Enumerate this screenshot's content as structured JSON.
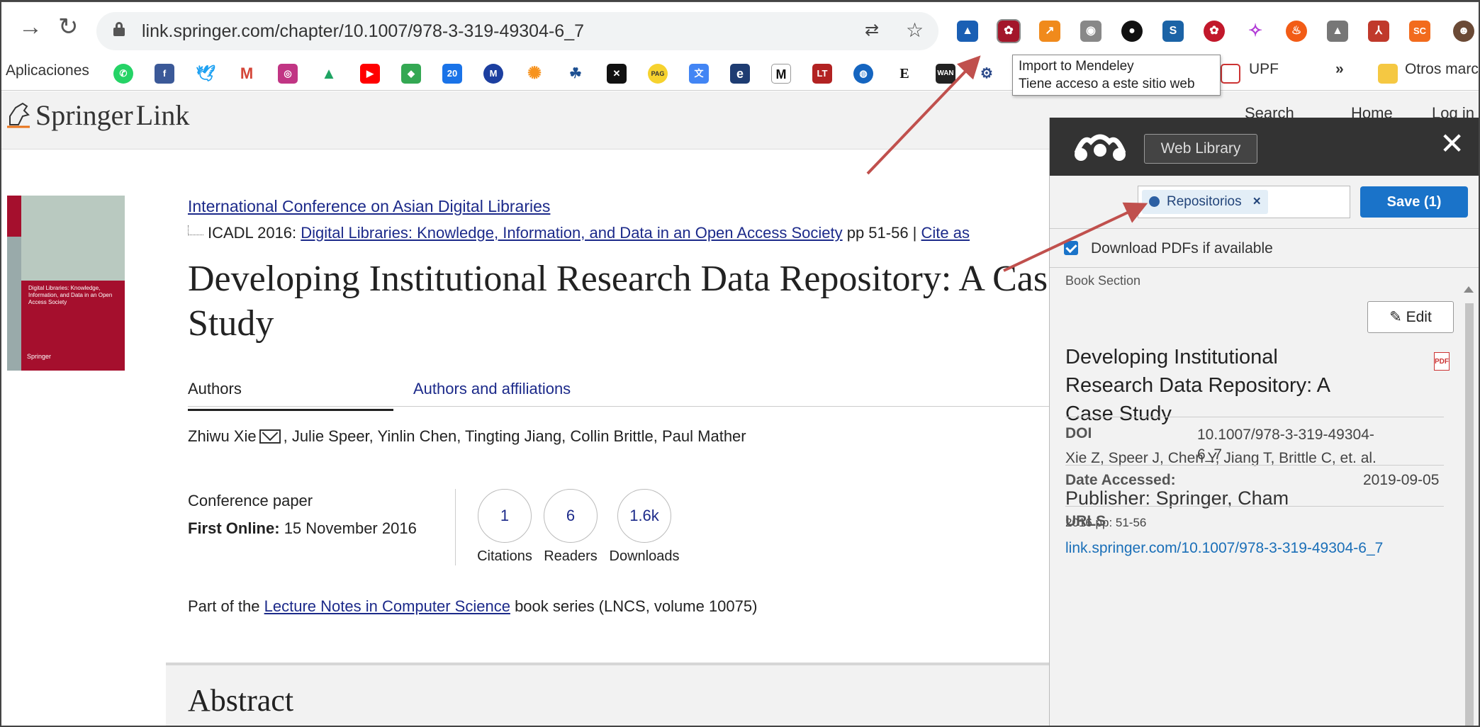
{
  "browser": {
    "url": "link.springer.com/chapter/10.1007/978-3-319-49304-6_7",
    "extensions": [
      "graduation-cap",
      "mendeley",
      "chart",
      "camera",
      "circle",
      "bookmark",
      "mendeley-red",
      "star",
      "fire",
      "drive",
      "pdf",
      "sc"
    ],
    "extension_labels": {
      "sc": "SC"
    }
  },
  "bookmarks": {
    "apps_label": "Aplicaciones",
    "items": [
      "whatsapp",
      "facebook",
      "twitter",
      "gmail",
      "instagram",
      "drive",
      "youtube",
      "maps",
      "calendar",
      "m-circle",
      "sun",
      "puzzle",
      "x-app",
      "pag",
      "translate",
      "e-app",
      "medium",
      "lt",
      "globe",
      "e-letter",
      "wan",
      "gear"
    ],
    "item_labels": {
      "calendar": "20",
      "m-circle": "M",
      "pag": "PAG",
      "e-app": "e",
      "medium": "M",
      "lt": "LT",
      "e-letter": "E",
      "wan": "WAN"
    },
    "upf_label": "UPF",
    "more_label": "»",
    "others_label": "Otros marc"
  },
  "tooltip": {
    "line1": "Import to Mendeley",
    "line2": "Tiene acceso a este sitio web"
  },
  "springer": {
    "logo_text_1": "Springer",
    "logo_text_2": "Link",
    "nav_search": "Search",
    "nav_home": "Home",
    "nav_login": "Log in"
  },
  "article": {
    "cover_text": "Digital Libraries: Knowledge, Information, and Data in an Open Access Society",
    "cover_publisher": "Springer",
    "conference_link": "International Conference on Asian Digital Libraries",
    "icadl_prefix": "ICADL 2016:",
    "icadl_link": "Digital Libraries: Knowledge, Information, and Data in an Open Access Society",
    "icadl_pages": "pp 51-56 |",
    "cite_as": "Cite as",
    "title": "Developing Institutional Research Data Repository: A Case Study",
    "tab_authors": "Authors",
    "tab_affiliations": "Authors and affiliations",
    "author_first": "Zhiwu Xie",
    "authors_rest": ", Julie Speer, Yinlin Chen, Tingting Jiang, Collin Brittle, Paul Mather",
    "paper_type": "Conference paper",
    "first_online_label": "First Online:",
    "first_online_date": "15 November 2016",
    "metrics": [
      {
        "value": "1",
        "label": "Citations"
      },
      {
        "value": "6",
        "label": "Readers"
      },
      {
        "value": "1.6k",
        "label": "Downloads"
      }
    ],
    "part_of_prefix": "Part of the",
    "series_link": "Lecture Notes in Computer Science",
    "part_of_suffix": "book series (LNCS, volume 10075)",
    "abstract_heading": "Abstract"
  },
  "mendeley": {
    "web_library": "Web Library",
    "close": "✕",
    "tag": "Repositorios",
    "tag_remove": "×",
    "save_button": "Save (1)",
    "download_pdfs": "Download PDFs if available",
    "download_checked": true,
    "item_type": "Book Section",
    "edit_button": "Edit",
    "pdf_badge": "PDF",
    "title": "Developing Institutional Research Data Repository: A Case Study",
    "authors": "Xie Z,  Speer J,  Chen Y,  Jiang T,  Brittle C, et. al.",
    "publisher": "Publisher: Springer, Cham",
    "year_pages": "2016 pp: 51-56",
    "doi_label": "DOI",
    "doi_value_1": "10.1007/978-3-319-49304-",
    "doi_value_2": "6_7",
    "date_accessed_label": "Date Accessed:",
    "date_accessed_value": "2019-09-05",
    "urls_label": "URLS",
    "url_value": "link.springer.com/10.1007/978-3-319-49304-6_7"
  },
  "colors": {
    "springer_link": "#1c2a8a",
    "mendeley_header": "#333333",
    "save_blue": "#1a73c9",
    "arrow_red": "#c0504d"
  }
}
